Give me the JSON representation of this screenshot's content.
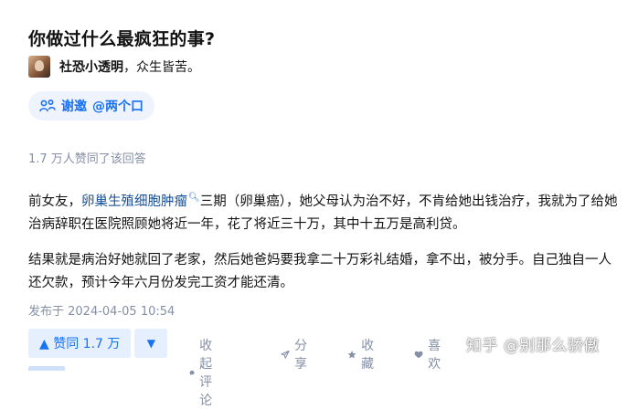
{
  "question": {
    "title": "你做过什么最疯狂的事?"
  },
  "author": {
    "name": "社恐小透明",
    "separator": "，",
    "bio": "众生皆苦。"
  },
  "invite": {
    "label": "谢邀",
    "mention": "@两个口"
  },
  "votes": {
    "summary": "1.7 万人赞同了该回答"
  },
  "content": {
    "p1_before": "前女友，",
    "p1_link": "卵巢生殖细胞肿瘤",
    "p1_after": "三期（卵巢癌），她父母认为治不好，不肯给她出钱治疗，我就为了给她治病辞职在医院照顾她将近一年，花了将近三十万，其中十五万是高利贷。",
    "p2": "结果就是病治好她就回了老家，然后她爸妈要我拿二十万彩礼结婚，拿不出，被分手。自己独自一人还欠款，预计今年六月份发完工资才能还清。"
  },
  "publish": {
    "text": "发布于 2024-04-05 10:54"
  },
  "actions": {
    "upvote": "▲ 赞同 1.7 万",
    "downvote": "▼",
    "comment": "收起评论",
    "share": "分享",
    "favorite": "收藏",
    "like": "喜欢"
  },
  "watermark": "知乎 @别那么骄傲",
  "colors": {
    "accent": "#1772f6",
    "muted": "#8590a6",
    "link": "#175199",
    "chip_bg": "#eef3fd"
  }
}
